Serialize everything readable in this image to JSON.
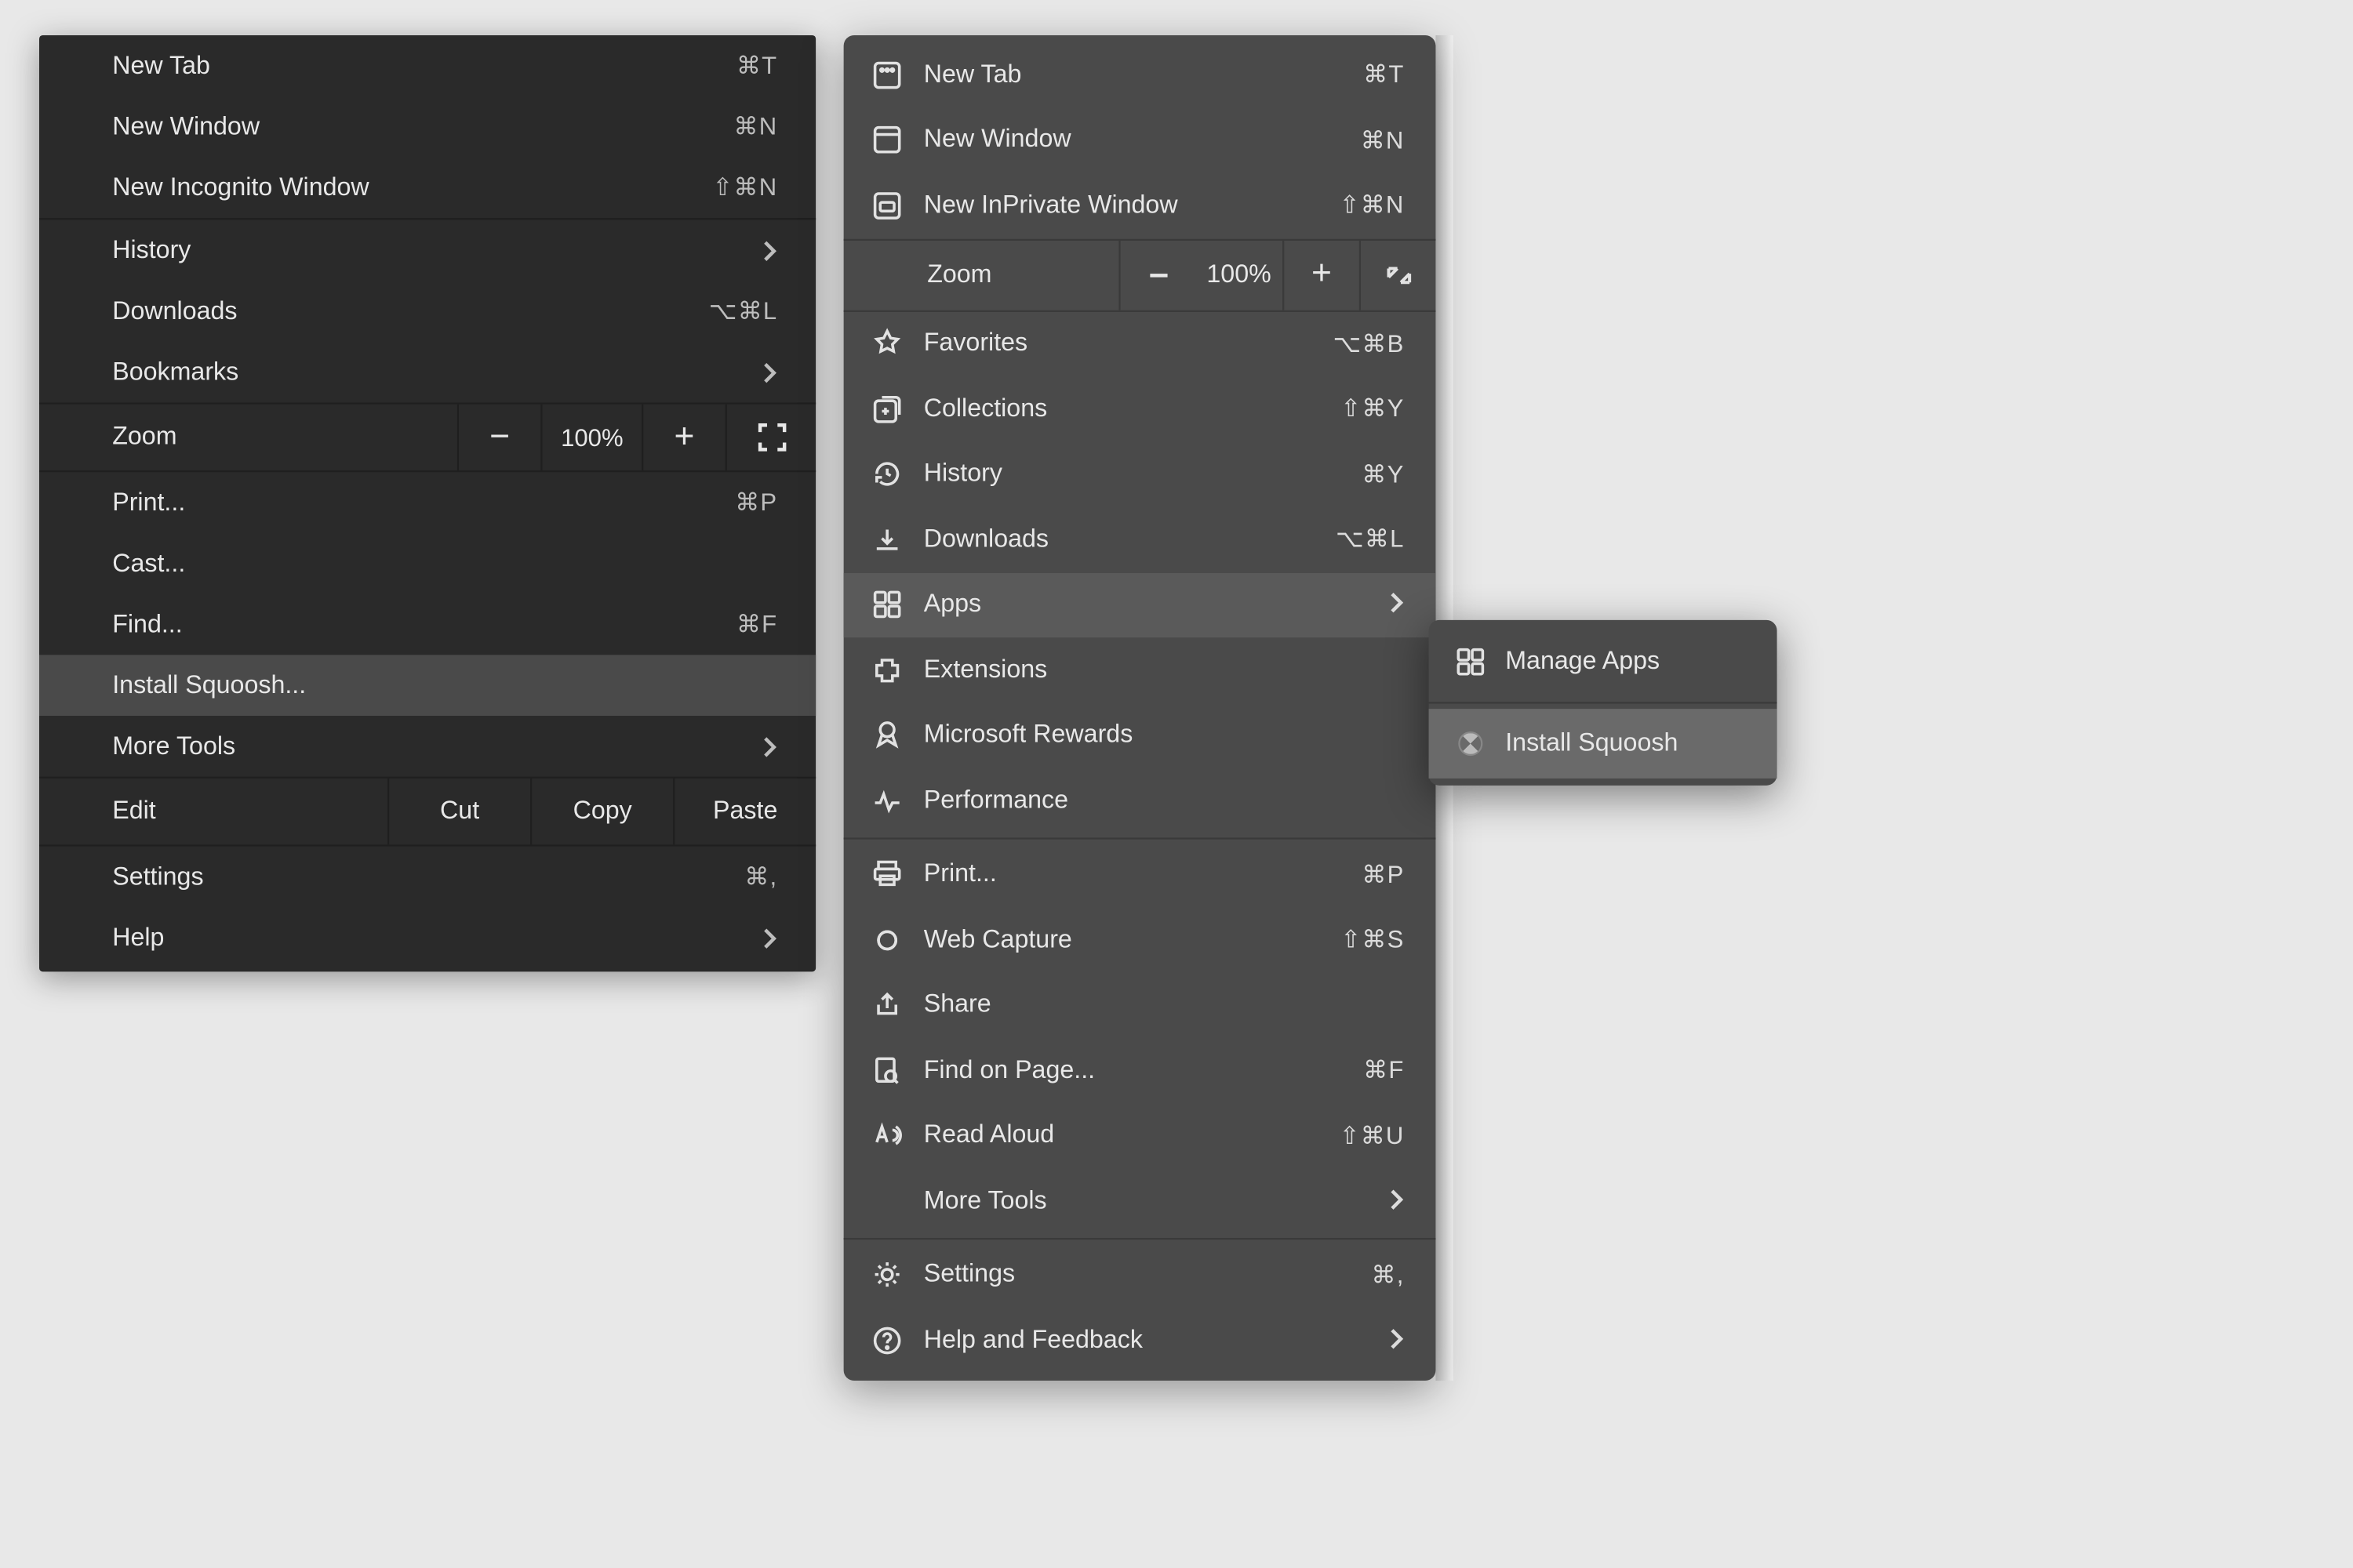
{
  "chrome_menu": {
    "items": [
      {
        "label": "New Tab",
        "shortcut": "⌘T"
      },
      {
        "label": "New Window",
        "shortcut": "⌘N"
      },
      {
        "label": "New Incognito Window",
        "shortcut": "⇧⌘N"
      }
    ],
    "history": {
      "label": "History"
    },
    "downloads": {
      "label": "Downloads",
      "shortcut": "⌥⌘L"
    },
    "bookmarks": {
      "label": "Bookmarks"
    },
    "zoom": {
      "label": "Zoom",
      "value": "100%"
    },
    "print": {
      "label": "Print...",
      "shortcut": "⌘P"
    },
    "cast": {
      "label": "Cast..."
    },
    "find": {
      "label": "Find...",
      "shortcut": "⌘F"
    },
    "install": {
      "label": "Install Squoosh..."
    },
    "more_tools": {
      "label": "More Tools"
    },
    "edit": {
      "label": "Edit",
      "cut": "Cut",
      "copy": "Copy",
      "paste": "Paste"
    },
    "settings": {
      "label": "Settings",
      "shortcut": "⌘,"
    },
    "help": {
      "label": "Help"
    }
  },
  "edge_menu": {
    "new_tab": {
      "label": "New Tab",
      "shortcut": "⌘T"
    },
    "new_window": {
      "label": "New Window",
      "shortcut": "⌘N"
    },
    "new_inprivate": {
      "label": "New InPrivate Window",
      "shortcut": "⇧⌘N"
    },
    "zoom": {
      "label": "Zoom",
      "value": "100%"
    },
    "favorites": {
      "label": "Favorites",
      "shortcut": "⌥⌘B"
    },
    "collections": {
      "label": "Collections",
      "shortcut": "⇧⌘Y"
    },
    "history": {
      "label": "History",
      "shortcut": "⌘Y"
    },
    "downloads": {
      "label": "Downloads",
      "shortcut": "⌥⌘L"
    },
    "apps": {
      "label": "Apps"
    },
    "extensions": {
      "label": "Extensions"
    },
    "rewards": {
      "label": "Microsoft Rewards"
    },
    "performance": {
      "label": "Performance"
    },
    "print": {
      "label": "Print...",
      "shortcut": "⌘P"
    },
    "web_capture": {
      "label": "Web Capture",
      "shortcut": "⇧⌘S"
    },
    "share": {
      "label": "Share"
    },
    "find": {
      "label": "Find on Page...",
      "shortcut": "⌘F"
    },
    "read_aloud": {
      "label": "Read Aloud",
      "shortcut": "⇧⌘U"
    },
    "more_tools": {
      "label": "More Tools"
    },
    "settings": {
      "label": "Settings",
      "shortcut": "⌘,"
    },
    "help": {
      "label": "Help and Feedback"
    }
  },
  "apps_submenu": {
    "manage": {
      "label": "Manage Apps"
    },
    "install": {
      "label": "Install Squoosh"
    }
  }
}
